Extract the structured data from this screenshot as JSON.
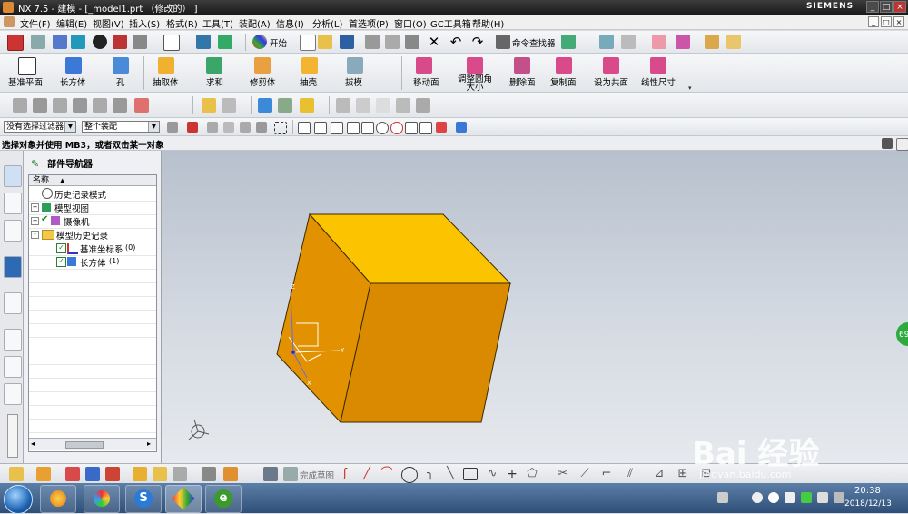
{
  "window": {
    "title": "NX 7.5 - 建模 - [_model1.prt （修改的） ]",
    "brand": "SIEMENS",
    "controls": [
      "_",
      "□",
      "×"
    ]
  },
  "menu": {
    "items": [
      "文件(F)",
      "编辑(E)",
      "视图(V)",
      "插入(S)",
      "格式(R)",
      "工具(T)",
      "装配(A)",
      "信息(I)",
      "分析(L)",
      "首选项(P)",
      "窗口(O)",
      "GC工具箱",
      "帮助(H)"
    ],
    "mdi_controls": [
      "_",
      "□",
      "×"
    ]
  },
  "toolbar1": {
    "start_label": "开始",
    "command_finder_label": "命令查找器"
  },
  "feature_toolbar": {
    "buttons": [
      "基准平面",
      "长方体",
      "孔",
      "抽取体",
      "求和",
      "修剪体",
      "抽壳",
      "拔模",
      "移动面",
      "调整圆角大小",
      "删除面",
      "复制面",
      "设为共面",
      "线性尺寸"
    ]
  },
  "selection_bar": {
    "filter_value": "没有选择过滤器",
    "scope_value": "整个装配"
  },
  "cue_line": {
    "text": "选择对象并使用 MB3，或者双击某一对象"
  },
  "navigator": {
    "title": "部件导航器",
    "column_header": "名称",
    "nodes": [
      {
        "label": "历史记录模式",
        "level": 0,
        "expander": ""
      },
      {
        "label": "模型视图",
        "level": 0,
        "expander": "+"
      },
      {
        "label": "摄像机",
        "level": 0,
        "expander": "+"
      },
      {
        "label": "模型历史记录",
        "level": 0,
        "expander": "-"
      },
      {
        "label": "基准坐标系",
        "suffix": "(0)",
        "level": 1,
        "expander": ""
      },
      {
        "label": "长方体",
        "suffix": "(1)",
        "level": 1,
        "expander": ""
      }
    ]
  },
  "viewport": {
    "model": "block",
    "face_colors": {
      "top": "#fcc400",
      "front": "#d98a00",
      "side": "#e29200"
    },
    "csys_axes": [
      "Z",
      "Y",
      "X"
    ],
    "side_badge": "69"
  },
  "sketch_toolbar": {
    "finish_sketch_label": "完成草图"
  },
  "taskbar": {
    "time": "20:38",
    "date": "2018/12/13"
  },
  "watermark": {
    "brand": "Bai 经验",
    "url": "jingyan.baidu.com"
  },
  "colors": {
    "accent": "#1f5fae",
    "cube_top": "#fcc400",
    "cube_front": "#d98a00"
  }
}
